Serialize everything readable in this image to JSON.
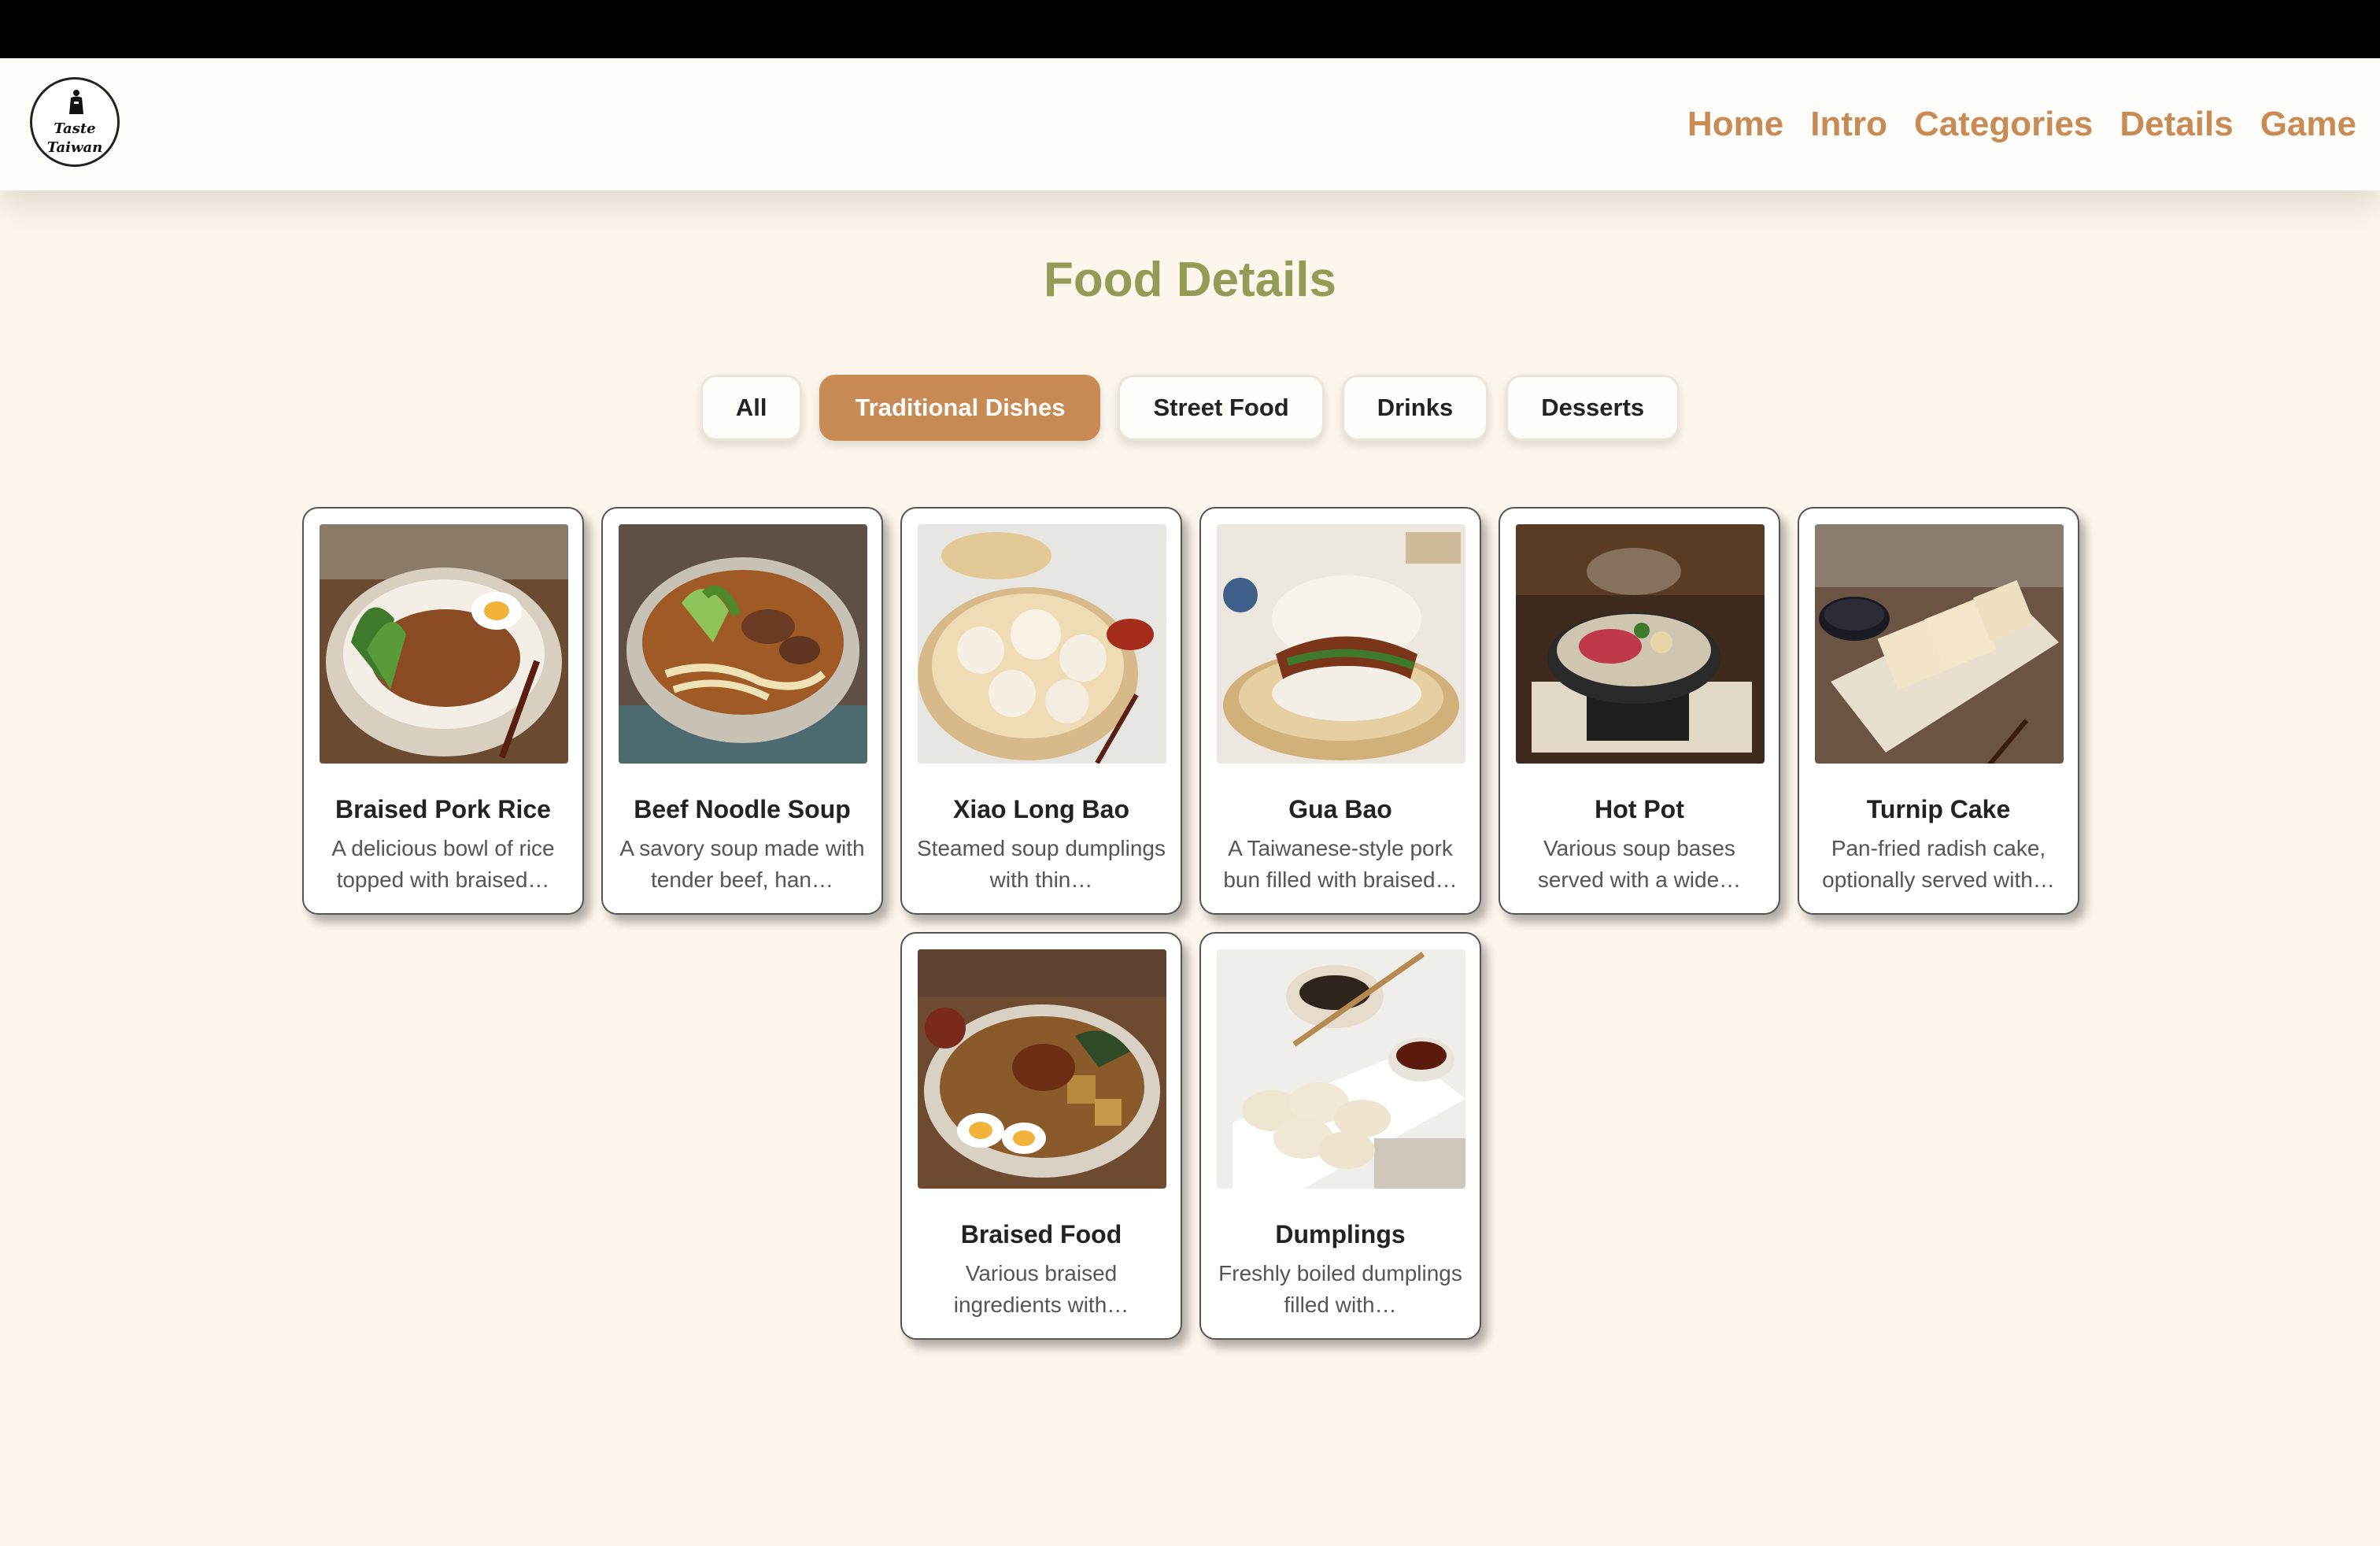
{
  "logo": {
    "line1": "Taste",
    "line2": "Taiwan"
  },
  "nav": [
    "Home",
    "Intro",
    "Categories",
    "Details",
    "Game"
  ],
  "page_title": "Food Details",
  "filters": [
    {
      "label": "All",
      "active": false
    },
    {
      "label": "Traditional Dishes",
      "active": true
    },
    {
      "label": "Street Food",
      "active": false
    },
    {
      "label": "Drinks",
      "active": false
    },
    {
      "label": "Desserts",
      "active": false
    }
  ],
  "colors": {
    "accent": "#c98b55",
    "title": "#939b57",
    "background": "#fdf6ec"
  },
  "foods": [
    {
      "name": "Braised Pork Rice",
      "desc": "A delicious bowl of rice topped with braised…",
      "image": "braised-pork-rice-photo"
    },
    {
      "name": "Beef Noodle Soup",
      "desc": "A savory soup made with tender beef, han…",
      "image": "beef-noodle-soup-photo"
    },
    {
      "name": "Xiao Long Bao",
      "desc": "Steamed soup dumplings with thin…",
      "image": "xiao-long-bao-photo"
    },
    {
      "name": "Gua Bao",
      "desc": "A Taiwanese-style pork bun filled with braised…",
      "image": "gua-bao-photo"
    },
    {
      "name": "Hot Pot",
      "desc": "Various soup bases served with a wide…",
      "image": "hot-pot-photo"
    },
    {
      "name": "Turnip Cake",
      "desc": "Pan-fried radish cake, optionally served with…",
      "image": "turnip-cake-photo"
    },
    {
      "name": "Braised Food",
      "desc": "Various braised ingredients with…",
      "image": "braised-food-photo"
    },
    {
      "name": "Dumplings",
      "desc": "Freshly boiled dumplings filled with…",
      "image": "dumplings-photo"
    }
  ]
}
